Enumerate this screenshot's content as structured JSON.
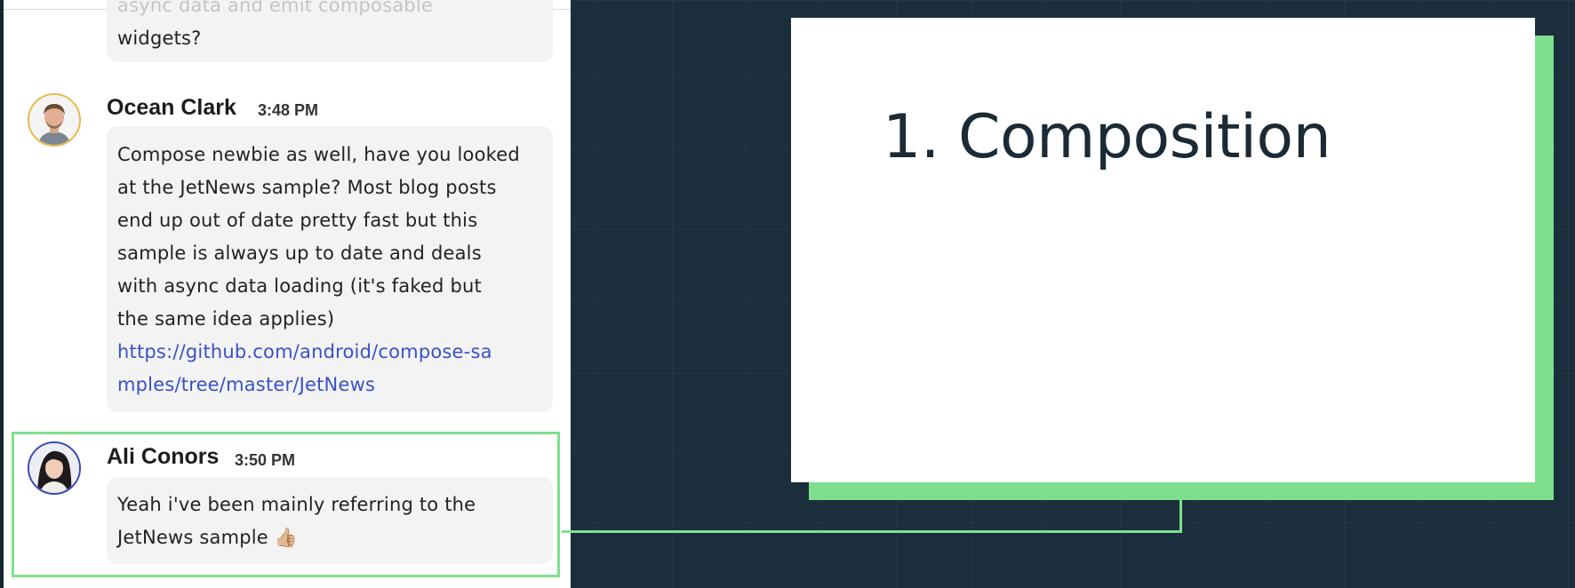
{
  "chat": {
    "previous_message": {
      "lines": [
        "async data and emit composable",
        "widgets?"
      ]
    },
    "messages": [
      {
        "sender": "Ocean Clark",
        "time": "3:48 PM",
        "lines": [
          "Compose newbie as well, have you looked",
          "at the JetNews sample? Most blog posts",
          "end up out of date pretty fast but this",
          "sample is always up to date and deals",
          "with async data loading (it's faked but",
          "the same idea applies)"
        ],
        "link_lines": [
          "https://github.com/android/compose-sa",
          "mples/tree/master/JetNews"
        ],
        "avatar_icon": "man-avatar-icon",
        "avatar_ring_color": "#e8b84a"
      },
      {
        "sender": "Ali Conors",
        "time": "3:50 PM",
        "lines": [
          "Yeah i've been mainly referring to the",
          "JetNews sample"
        ],
        "emoji": "👍🏼",
        "avatar_icon": "woman-avatar-icon",
        "avatar_ring_color": "#3a46b8"
      }
    ]
  },
  "slide": {
    "title": "1. Composition"
  },
  "colors": {
    "background": "#1a2e3b",
    "accent_green": "#7ee08e",
    "link": "#3751c8",
    "bubble": "#f3f3f3"
  }
}
